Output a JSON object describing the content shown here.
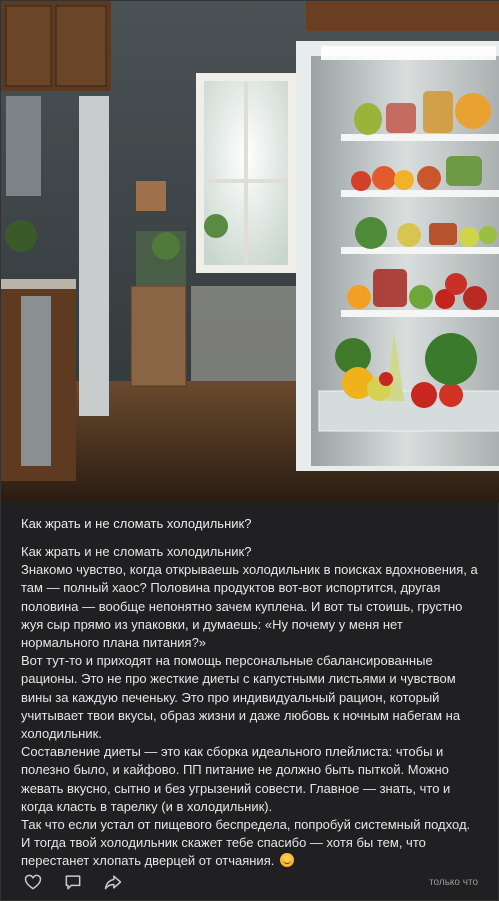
{
  "post": {
    "image_alt": "Открытый холодильник с овощами и фруктами на кухне",
    "title": "Как жрать и не сломать холодильник?",
    "paragraphs": [
      "Как жрать и не сломать холодильник?",
      "Знакомо чувство, когда открываешь холодильник в поисках вдохновения, а там — полный хаос? Половина продуктов вот-вот испортится, другая половина — вообще непонятно зачем куплена. И вот ты стоишь, грустно жуя сыр прямо из упаковки, и думаешь: «Ну почему у меня нет нормального плана питания?»",
      "Вот тут-то и приходят на помощь персональные сбалансированные рационы. Это не про жесткие диеты с капустными листьями и чувством вины за каждую печеньку. Это про индивидуальный рацион, который учитывает твои вкусы, образ жизни и даже любовь к ночным набегам на холодильник.",
      "Составление диеты — это как сборка идеального плейлиста: чтобы и полезно было, и кайфово. ПП питание не должно быть пыткой. Можно жевать вкусно, сытно и без угрызений совести. Главное — знать, что и когда класть в тарелку (и в холодильник).",
      "Так что если устал от пищевого беспредела, попробуй системный подход. И тогда твой холодильник скажет тебе спасибо — хотя бы тем, что перестанет хлопать дверцей от отчаяния."
    ],
    "timestamp": "только что"
  },
  "icons": {
    "like": "heart-icon",
    "comment": "comment-icon",
    "share": "share-icon",
    "emoji": "smirk-emoji-icon"
  },
  "colors": {
    "card_bg": "#202022",
    "text": "#e6e6e6",
    "muted": "#9a9a9a"
  }
}
